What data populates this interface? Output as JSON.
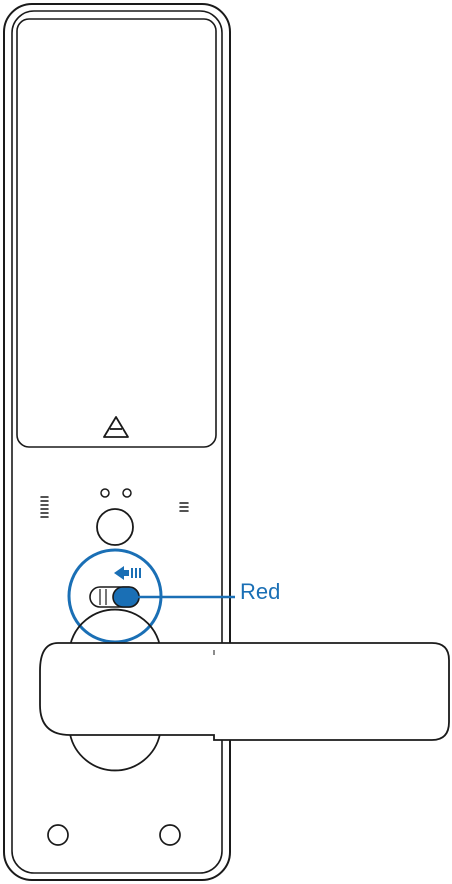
{
  "callout": {
    "label": "Red",
    "color": "#1a6fb5"
  },
  "colors": {
    "outline": "#1a1a1a",
    "accent": "#1a6fb5",
    "background": "#ffffff"
  }
}
